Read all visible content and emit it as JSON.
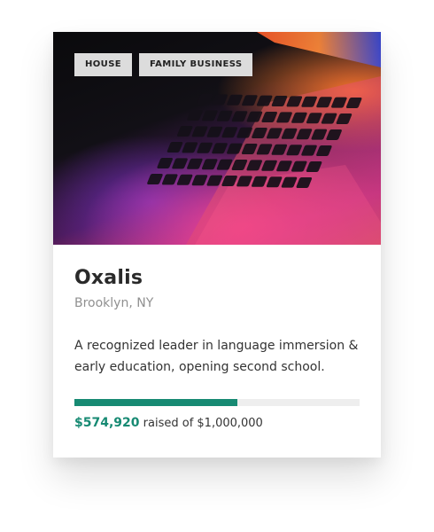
{
  "card": {
    "tags": [
      "HOUSE",
      "FAMILY BUSINESS"
    ],
    "title": "Oxalis",
    "location": "Brooklyn, NY",
    "description": "A recognized leader in language immersion & early education, opening second school.",
    "raised_amount": "$574,920",
    "raised_text": "raised of $1,000,000",
    "progress_fraction": 0.57,
    "image": "laptop-keyboard-photo"
  },
  "colors": {
    "accent": "#178a73",
    "track": "#eeeeee",
    "tag_bg": "#dcdcdc"
  }
}
